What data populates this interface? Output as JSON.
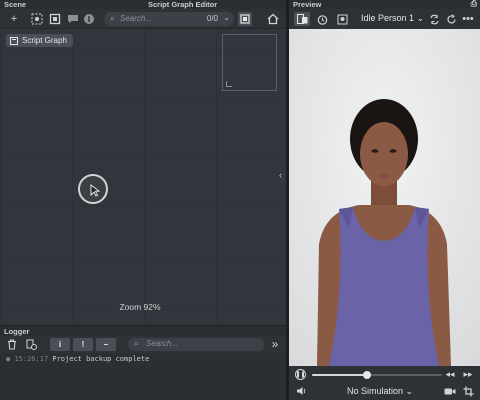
{
  "scene": {
    "title": "Scene"
  },
  "editor": {
    "title": "Script Graph Editor",
    "search": {
      "placeholder": "Search...",
      "count": "0/0"
    },
    "chip_label": "Script Graph",
    "zoom_label": "Zoom 92%"
  },
  "logger": {
    "title": "Logger",
    "filter_info": "i",
    "filter_warn": "!",
    "filter_error": "–",
    "search_placeholder": "Search...",
    "entries": [
      {
        "time": "15:26:17",
        "message": "Project backup complete"
      }
    ]
  },
  "preview": {
    "title": "Preview",
    "person": "Idle Person 1",
    "simulation": "No Simulation",
    "playback_position": 0.42
  },
  "icons": {
    "add": "plus-icon",
    "gear": "gear-icon",
    "search": "search-icon",
    "home": "home-icon",
    "trash": "trash-icon",
    "camera": "camera-icon",
    "crop": "crop-icon",
    "speaker": "speaker-icon"
  },
  "colors": {
    "panel_bg": "#33373d",
    "toolbar_bg": "#2e3136",
    "accent_text": "#e3e5e8",
    "tank_top": "#6b63a8",
    "skin": "#8a5a45"
  }
}
